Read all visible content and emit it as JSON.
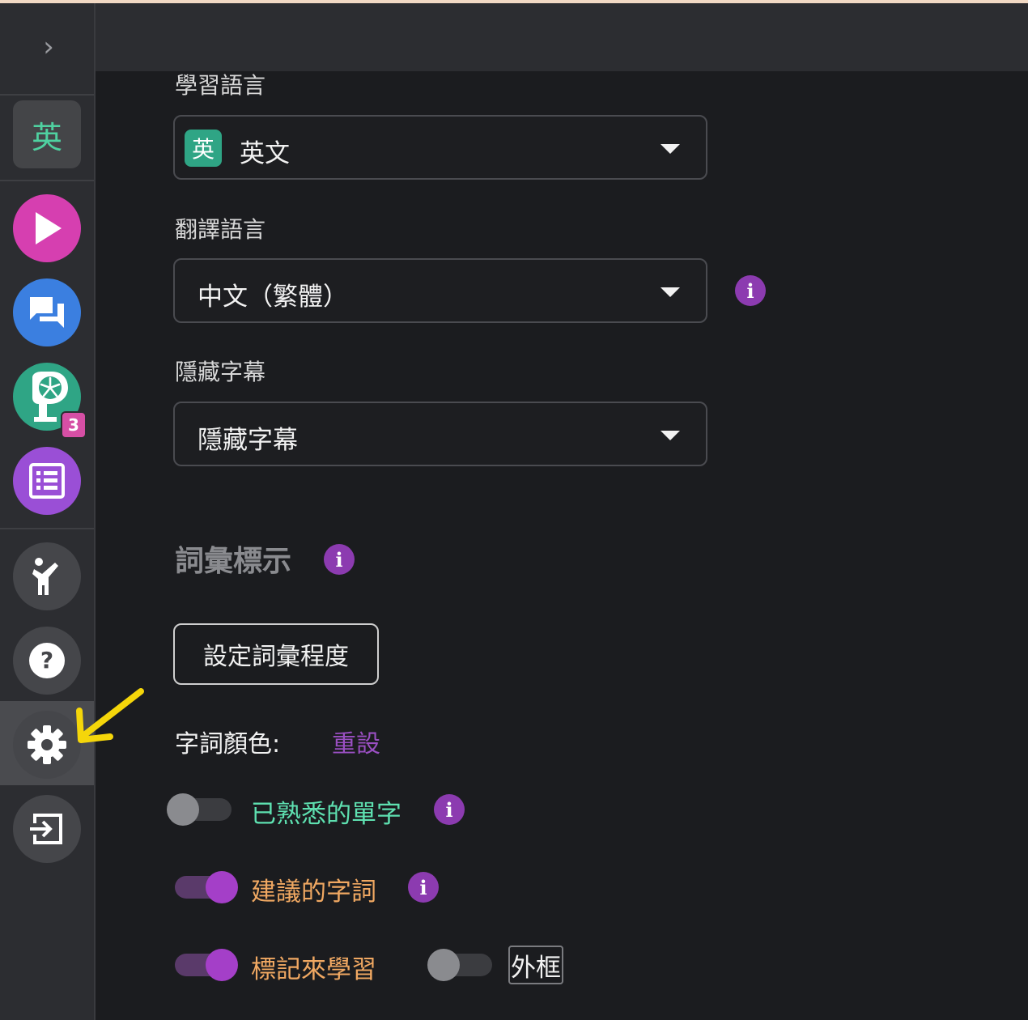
{
  "sidebar": {
    "toggle_icon": "chevron-right-icon",
    "language_tile": "英",
    "nav_items": [
      {
        "name": "play",
        "icon": "play-icon",
        "color": "#d63fb0"
      },
      {
        "name": "chat",
        "icon": "chat-bubbles-icon",
        "color": "#3b7fe0"
      },
      {
        "name": "pinwheel",
        "icon": "pinwheel-icon",
        "color": "#2fa585",
        "badge": "3"
      },
      {
        "name": "list",
        "icon": "list-icon",
        "color": "#9a4fd6"
      },
      {
        "name": "accessibility",
        "icon": "person-icon",
        "color": "#45464a"
      },
      {
        "name": "help",
        "icon": "question-icon",
        "color": "#45464a"
      },
      {
        "name": "settings",
        "icon": "gear-icon",
        "color": "#45464a",
        "active": true
      },
      {
        "name": "logout",
        "icon": "exit-icon",
        "color": "#45464a"
      }
    ]
  },
  "settings": {
    "learning_language": {
      "label": "學習語言",
      "flag": "英",
      "value": "英文"
    },
    "translation_language": {
      "label": "翻譯語言",
      "value": "中文（繁體）"
    },
    "hide_subtitles": {
      "label": "隱藏字幕",
      "value": "隱藏字幕"
    },
    "vocab_section": {
      "title": "詞彙標示",
      "set_level_button": "設定詞彙程度"
    },
    "word_colors": {
      "label": "字詞顏色:",
      "reset": "重設"
    },
    "toggles": [
      {
        "label": "已熟悉的單字",
        "on": false,
        "color": "#5ee0b0"
      },
      {
        "label": "建議的字詞",
        "on": true,
        "color": "#f0a862"
      },
      {
        "label": "標記來學習",
        "on": true,
        "color": "#f0a862"
      }
    ],
    "outline": {
      "label": "外框",
      "on": false
    }
  },
  "colors": {
    "accent": "#8c3bb0",
    "background": "#1b1c1f",
    "annotation_arrow": "#f5d60a"
  }
}
